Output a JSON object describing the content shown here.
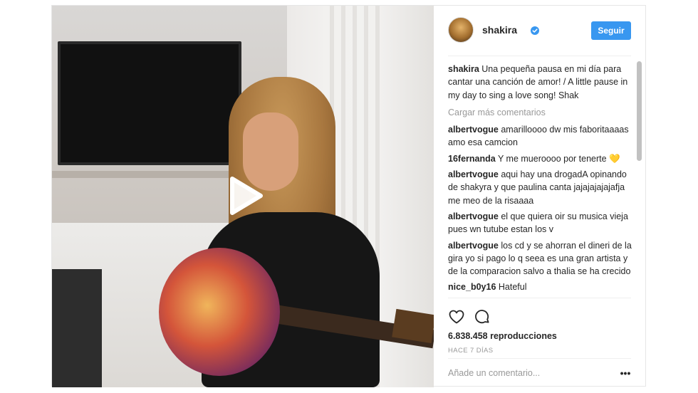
{
  "post": {
    "username": "shakira",
    "follow_label": "Seguir",
    "caption_user": "shakira",
    "caption_text": "Una pequeña pausa en mi día para cantar una canción de amor! / A little pause in my day to sing a love song! Shak",
    "load_more": "Cargar más comentarios",
    "comments": [
      {
        "user": "albertvogue",
        "text": "amarilloooo dw mis faboritaaaas amo esa camcion"
      },
      {
        "user": "16fernanda",
        "text": "Y me mueroooo por tenerte 💛"
      },
      {
        "user": "albertvogue",
        "text": "aqui hay una drogadA opinando de shakyra y que paulina canta jajajajajajafja me meo de la risaaaa"
      },
      {
        "user": "albertvogue",
        "text": "el que quiera oir su musica vieja pues wn tutube estan los v"
      },
      {
        "user": "albertvogue",
        "text": "los cd y se ahorran el dineri de la gira yo si pago lo q seea es una gran artista y de la comparacion salvo a thalia se ha crecido"
      },
      {
        "user": "nice_b0y16",
        "text": "Hateful"
      }
    ],
    "views": "6.838.458 reproducciones",
    "time_ago": "HACE 7 DÍAS",
    "add_comment_placeholder": "Añade un comentario...",
    "more_label": "•••"
  },
  "icons": {
    "like": "heart-icon",
    "comment": "comment-icon",
    "play": "play-icon",
    "verified": "verified-badge-icon"
  },
  "colors": {
    "accent": "#3897f0",
    "muted": "#999999",
    "text": "#262626"
  }
}
